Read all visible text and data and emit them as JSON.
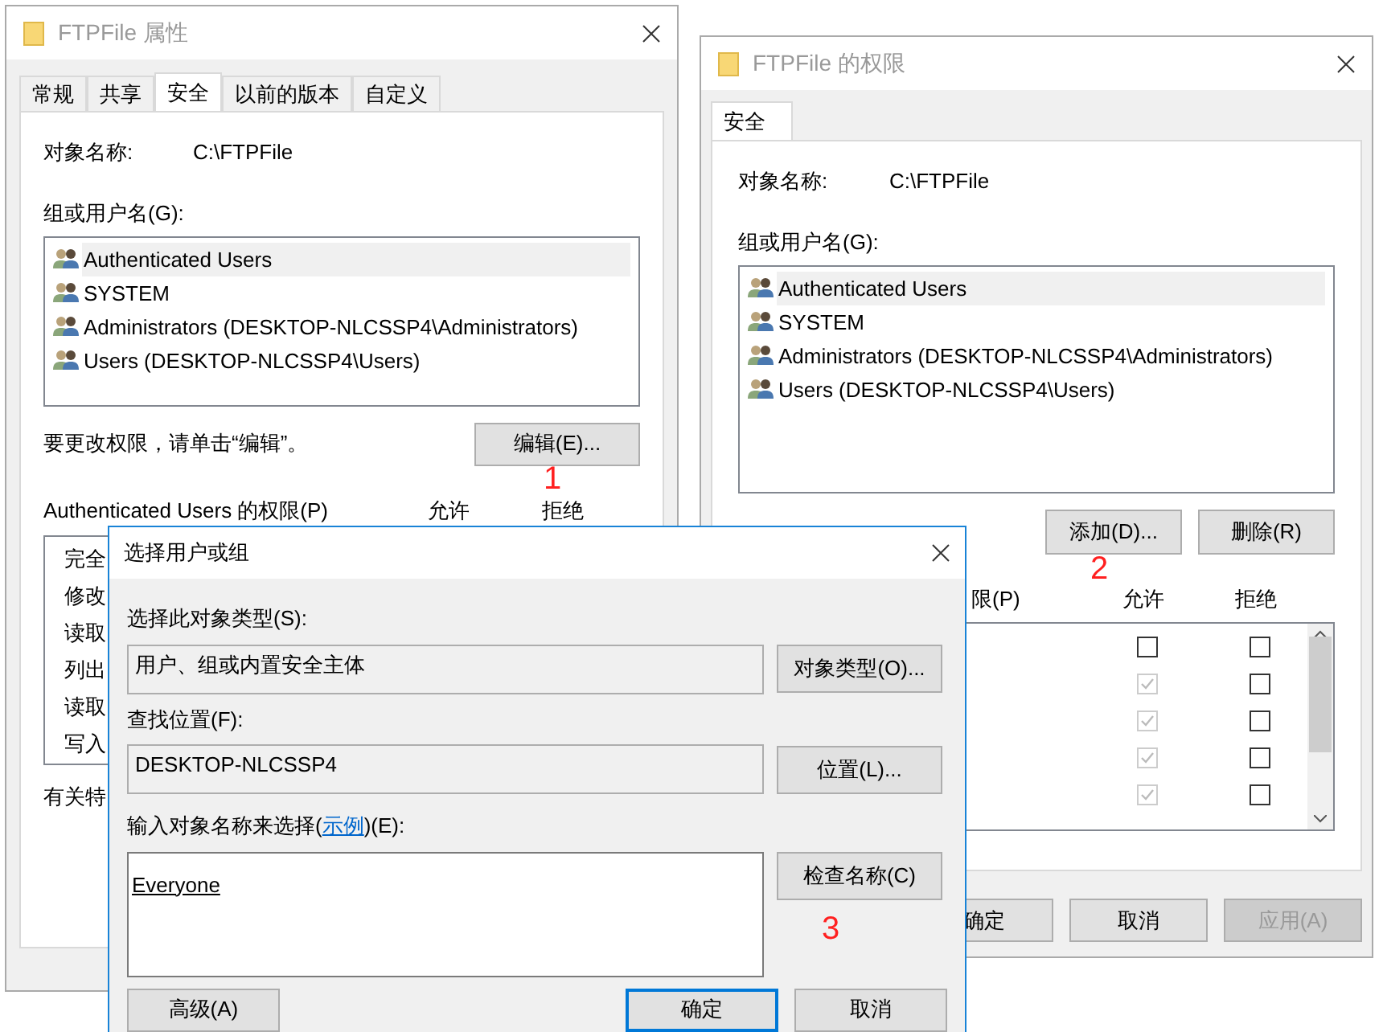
{
  "properties_window": {
    "title": "FTPFile 属性",
    "tabs": [
      {
        "label": "常规",
        "selected": false
      },
      {
        "label": "共享",
        "selected": false
      },
      {
        "label": "安全",
        "selected": true
      },
      {
        "label": "以前的版本",
        "selected": false
      },
      {
        "label": "自定义",
        "selected": false
      }
    ],
    "object_name_label": "对象名称:",
    "object_name": "C:\\FTPFile",
    "groups_label": "组或用户名(G):",
    "groups": [
      {
        "name": "Authenticated Users",
        "selected": true
      },
      {
        "name": "SYSTEM",
        "selected": false
      },
      {
        "name": "Administrators (DESKTOP-NLCSSP4\\Administrators)",
        "selected": false
      },
      {
        "name": "Users (DESKTOP-NLCSSP4\\Users)",
        "selected": false
      }
    ],
    "edit_hint": "要更改权限，请单击“编辑”。",
    "edit_button": "编辑(E)...",
    "permissions_label": "Authenticated Users 的权限(P)",
    "allow_header": "允许",
    "deny_header": "拒绝",
    "permissions": [
      "完全",
      "修改",
      "读取",
      "列出",
      "读取",
      "写入"
    ],
    "footer_note": "有关特"
  },
  "permissions_window": {
    "title": "FTPFile 的权限",
    "tabs": [
      {
        "label": "安全",
        "selected": true
      }
    ],
    "object_name_label": "对象名称:",
    "object_name": "C:\\FTPFile",
    "groups_label": "组或用户名(G):",
    "groups": [
      {
        "name": "Authenticated Users",
        "selected": true
      },
      {
        "name": "SYSTEM",
        "selected": false
      },
      {
        "name": "Administrators (DESKTOP-NLCSSP4\\Administrators)",
        "selected": false
      },
      {
        "name": "Users (DESKTOP-NLCSSP4\\Users)",
        "selected": false
      }
    ],
    "add_button": "添加(D)...",
    "remove_button": "删除(R)",
    "permissions_label": "限(P)",
    "allow_header": "允许",
    "deny_header": "拒绝",
    "permissions": [
      {
        "allow": {
          "checked": false,
          "disabled": false
        },
        "deny": {
          "checked": false,
          "disabled": false
        }
      },
      {
        "allow": {
          "checked": true,
          "disabled": true
        },
        "deny": {
          "checked": false,
          "disabled": false
        }
      },
      {
        "allow": {
          "checked": true,
          "disabled": true
        },
        "deny": {
          "checked": false,
          "disabled": false
        }
      },
      {
        "allow": {
          "checked": true,
          "disabled": true
        },
        "deny": {
          "checked": false,
          "disabled": false
        }
      },
      {
        "allow": {
          "checked": true,
          "disabled": true
        },
        "deny": {
          "checked": false,
          "disabled": false
        }
      }
    ],
    "buttons": [
      {
        "label": "确定",
        "disabled": false
      },
      {
        "label": "取消",
        "disabled": false
      },
      {
        "label": "应用(A)",
        "disabled": true
      }
    ]
  },
  "select_dialog": {
    "title": "选择用户或组",
    "object_type_label": "选择此对象类型(S):",
    "object_type": "用户、组或内置安全主体",
    "object_types_button": "对象类型(O)...",
    "location_label": "查找位置(F):",
    "location": "DESKTOP-NLCSSP4",
    "locations_button": "位置(L)...",
    "names_label_before": "输入对象名称来选择(",
    "names_link": "示例",
    "names_label_after": ")(E):",
    "names_value": "Everyone",
    "check_names_button": "检查名称(C)",
    "buttons": [
      {
        "label": "高级(A)",
        "default": false
      },
      {
        "label": "确定",
        "default": true
      },
      {
        "label": "取消",
        "default": false
      }
    ]
  },
  "annotations": [
    {
      "text": "1"
    },
    {
      "text": "2"
    },
    {
      "text": "3"
    }
  ]
}
